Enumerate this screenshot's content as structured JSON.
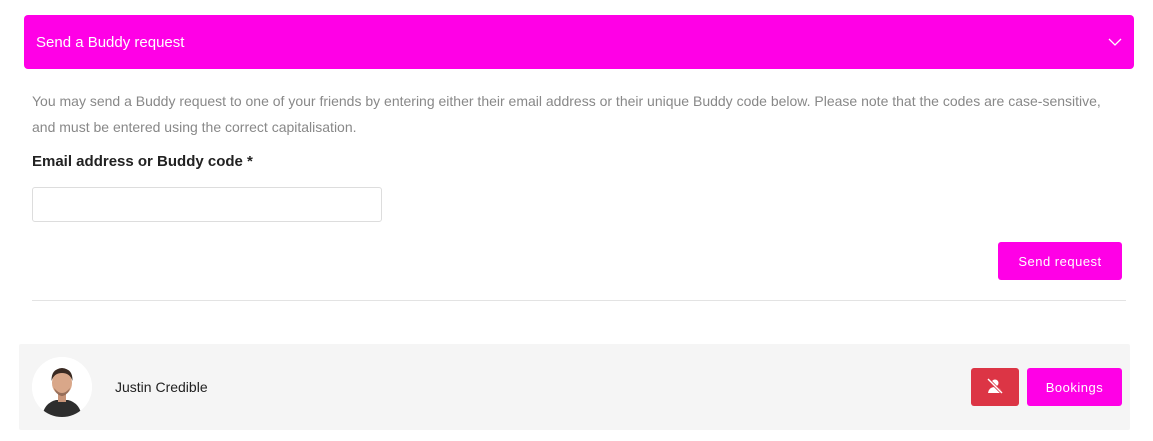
{
  "accordion": {
    "title": "Send a Buddy request",
    "icon": "chevron-down-icon"
  },
  "description": "You may send a Buddy request to one of your friends by entering either their email address or their unique Buddy code below. Please note that the codes are case-sensitive, and must be entered using the correct capitalisation.",
  "form": {
    "label": "Email address or Buddy code *",
    "value": "",
    "placeholder": "",
    "submit_label": "Send request"
  },
  "buddies": [
    {
      "name": "Justin Credible",
      "remove_icon": "user-remove-icon",
      "bookings_label": "Bookings"
    }
  ],
  "colors": {
    "accent": "#ff00e6",
    "danger": "#dc3545",
    "row_background": "#f5f5f5",
    "muted_text": "#888888"
  }
}
